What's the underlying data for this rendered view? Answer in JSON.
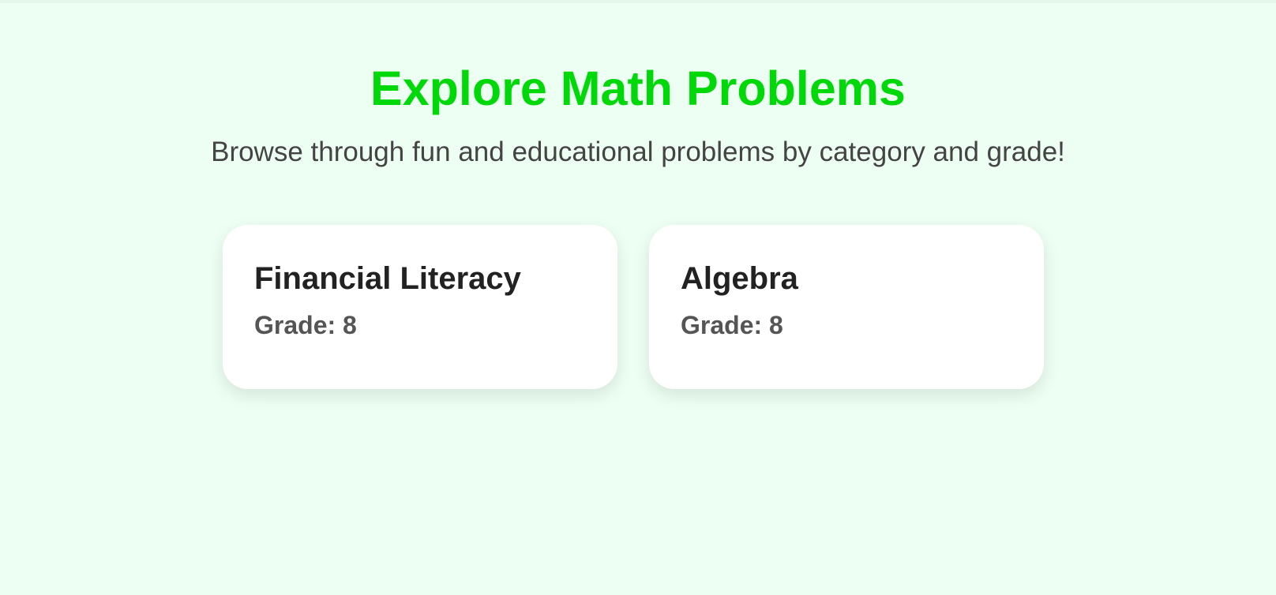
{
  "header": {
    "title": "Explore Math Problems",
    "subtitle": "Browse through fun and educational problems by category and grade!"
  },
  "cards": [
    {
      "title": "Financial Literacy",
      "grade": "Grade: 8"
    },
    {
      "title": "Algebra",
      "grade": "Grade: 8"
    }
  ],
  "colors": {
    "background": "#edfef2",
    "accent": "#00d80a",
    "card": "#ffffff"
  }
}
